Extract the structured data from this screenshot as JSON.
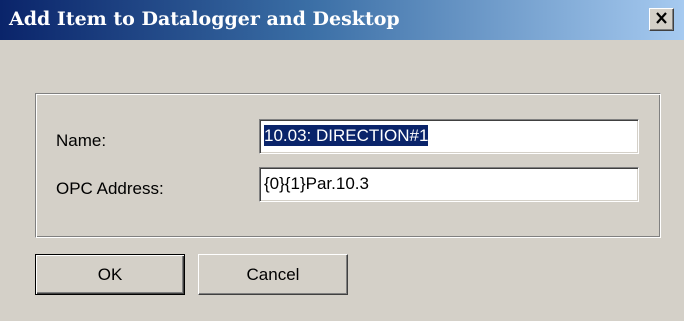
{
  "window": {
    "title": "Add Item to Datalogger and Desktop",
    "close_icon": "close-icon"
  },
  "form": {
    "name_label": "Name:",
    "name_value": "10.03: DIRECTION#1",
    "name_value_selected": true,
    "opc_label": "OPC Address:",
    "opc_value": "{0}{1}Par.10.3"
  },
  "buttons": {
    "ok_label": "OK",
    "cancel_label": "Cancel"
  },
  "colors": {
    "titlebar_start": "#0a246a",
    "titlebar_end": "#a6caf0",
    "dialog_face": "#d4d0c8",
    "selection": "#0a246a"
  }
}
